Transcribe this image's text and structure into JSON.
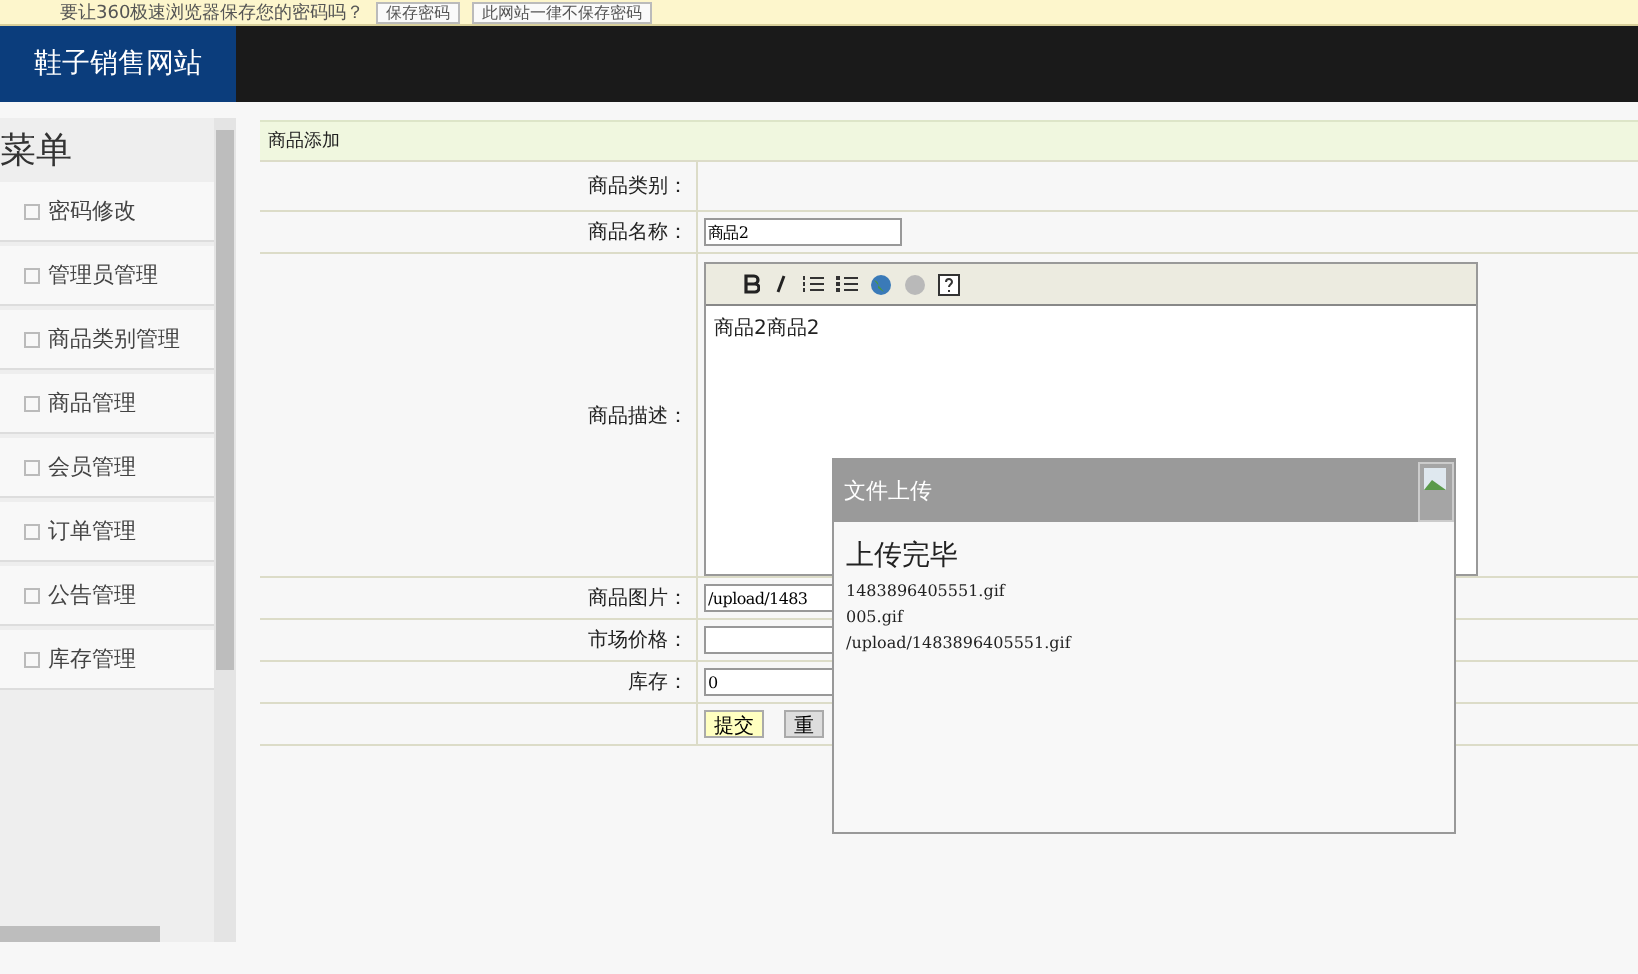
{
  "prompt_bar": {
    "message": "要让360极速浏览器保存您的密码吗？",
    "buttons": [
      "保存密码",
      "此网站一律不保存密码"
    ]
  },
  "header": {
    "brand": "鞋子销售网站"
  },
  "sidebar": {
    "title": "菜单",
    "items": [
      {
        "label": "密码修改"
      },
      {
        "label": "管理员管理"
      },
      {
        "label": "商品类别管理"
      },
      {
        "label": "商品管理"
      },
      {
        "label": "会员管理"
      },
      {
        "label": "订单管理"
      },
      {
        "label": "公告管理"
      },
      {
        "label": "库存管理"
      }
    ]
  },
  "form": {
    "title": "商品添加",
    "rows": [
      {
        "label": "商品类别：",
        "kind": "empty"
      },
      {
        "label": "商品名称：",
        "kind": "input",
        "value": "商品2"
      },
      {
        "label": "商品描述：",
        "kind": "editor",
        "value": "商品2商品2"
      },
      {
        "label": "商品图片：",
        "kind": "input",
        "value": "/upload/1483"
      },
      {
        "label": "市场价格：",
        "kind": "input",
        "value": ""
      },
      {
        "label": "库存：",
        "kind": "input",
        "value": "0"
      }
    ],
    "buttons": [
      {
        "label": "提交",
        "kind": "primary"
      },
      {
        "label": "重",
        "kind": "secondary"
      }
    ]
  },
  "dialog": {
    "title": "文件上传",
    "heading": "上传完毕",
    "lines": [
      "1483896405551.gif",
      "005.gif",
      "/upload/1483896405551.gif"
    ]
  }
}
